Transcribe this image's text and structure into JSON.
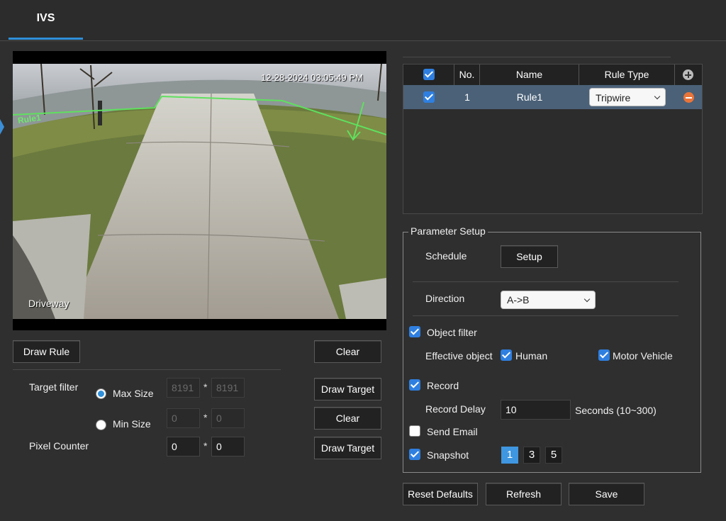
{
  "tabs": {
    "active": "IVS"
  },
  "video": {
    "timestamp": "12-28-2024 03:05:49 PM",
    "camera_label": "Driveway",
    "rule_overlay_label": "Rule1"
  },
  "left_controls": {
    "draw_rule": "Draw Rule",
    "clear": "Clear",
    "target_filter_label": "Target filter",
    "max_size_label": "Max Size",
    "max_w": "8191",
    "max_h": "8191",
    "draw_target": "Draw Target",
    "clear2": "Clear",
    "min_size_label": "Min Size",
    "min_w": "0",
    "min_h": "0",
    "pixel_counter_label": "Pixel Counter",
    "pixel_w": "0",
    "pixel_h": "0",
    "draw_target2": "Draw Target",
    "separator": "*"
  },
  "rules_table": {
    "headers": {
      "no": "No.",
      "name": "Name",
      "rule_type": "Rule Type"
    },
    "rows": [
      {
        "no": "1",
        "name": "Rule1",
        "rule_type": "Tripwire",
        "checked": true
      }
    ]
  },
  "parameter_setup": {
    "legend": "Parameter Setup",
    "schedule_label": "Schedule",
    "setup_button": "Setup",
    "direction_label": "Direction",
    "direction_value": "A->B",
    "object_filter_label": "Object filter",
    "effective_object_label": "Effective object",
    "human_label": "Human",
    "motor_vehicle_label": "Motor Vehicle",
    "record_label": "Record",
    "record_delay_label": "Record Delay",
    "record_delay_value": "10",
    "record_delay_unit": "Seconds (10~300)",
    "send_email_label": "Send Email",
    "snapshot_label": "Snapshot",
    "snapshot_options": [
      "1",
      "3",
      "5"
    ],
    "snapshot_selected": "1"
  },
  "footer": {
    "reset_defaults": "Reset Defaults",
    "refresh": "Refresh",
    "save": "Save"
  },
  "colors": {
    "accent": "#2f8fd8",
    "tripwire": "#6fe86f",
    "row_highlight": "#4a6178"
  }
}
